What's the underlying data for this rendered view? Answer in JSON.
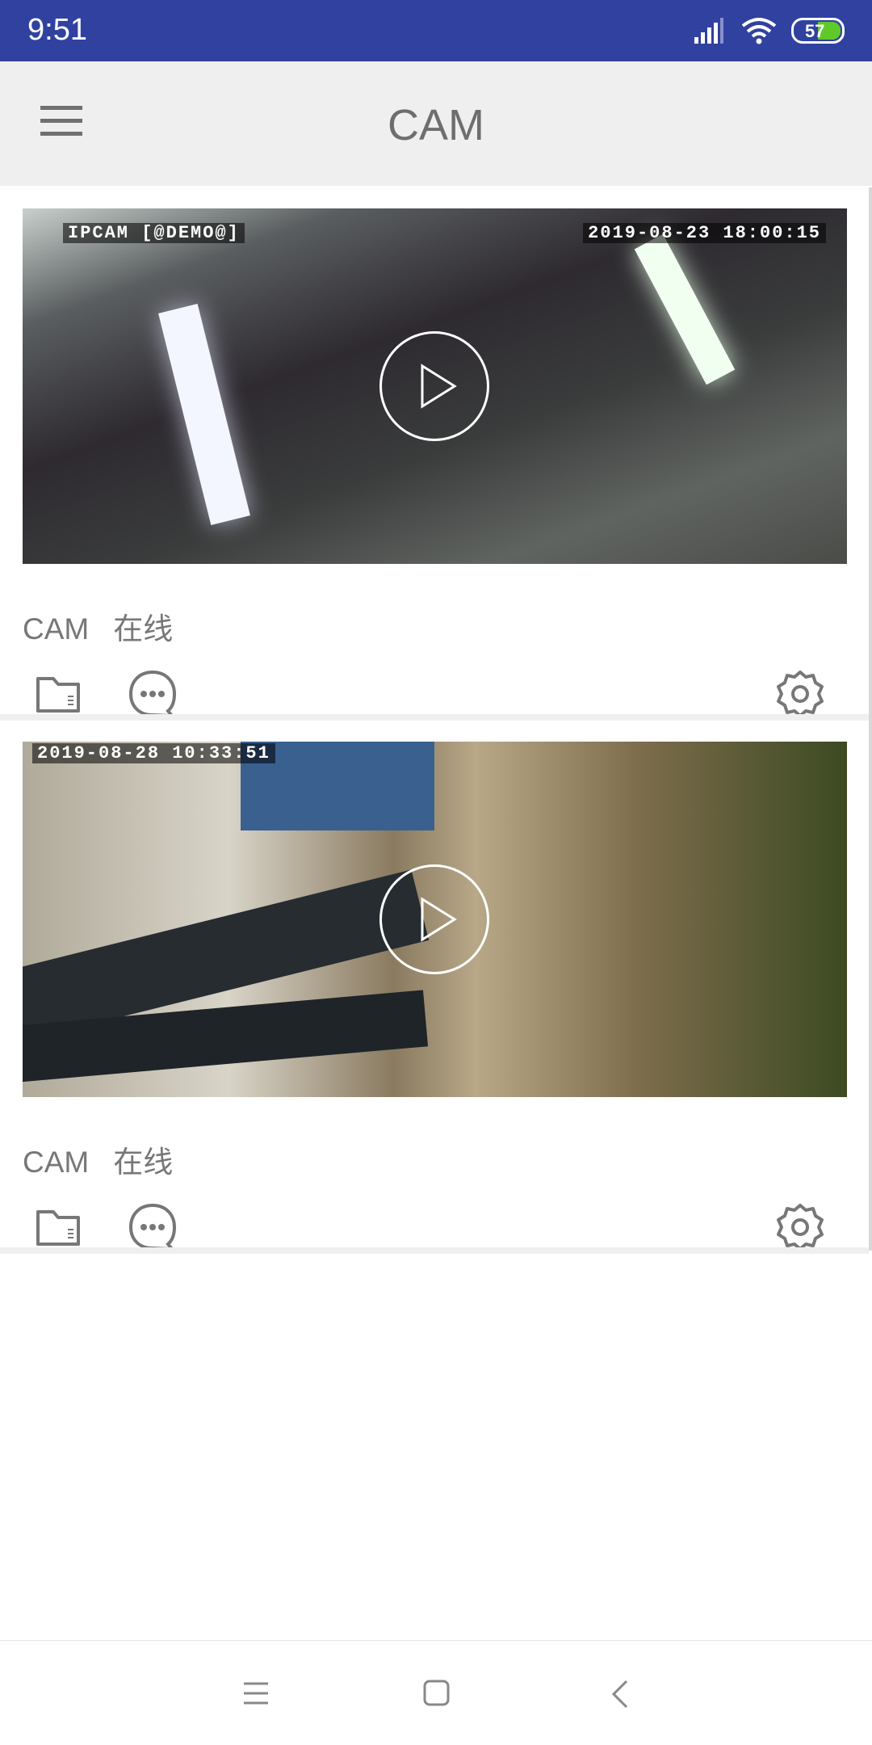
{
  "status_bar": {
    "time": "9:51",
    "battery": "57",
    "icons": [
      "signal-icon",
      "wifi-icon",
      "battery-icon"
    ]
  },
  "toolbar": {
    "title": "CAM",
    "menu_icon": "hamburger-menu-icon"
  },
  "cameras": [
    {
      "osd_name": "IPCAM [@DEMO@]",
      "osd_time": "2019-08-23 18:00:15",
      "name": "CAM",
      "status": "在线"
    },
    {
      "osd_name": "",
      "osd_time": "2019-08-28 10:33:51",
      "name": "CAM",
      "status": "在线"
    }
  ],
  "card_icons": [
    "folder-icon",
    "message-icon",
    "settings-icon"
  ],
  "nav_bar": [
    "recents-icon",
    "home-icon",
    "back-icon"
  ]
}
